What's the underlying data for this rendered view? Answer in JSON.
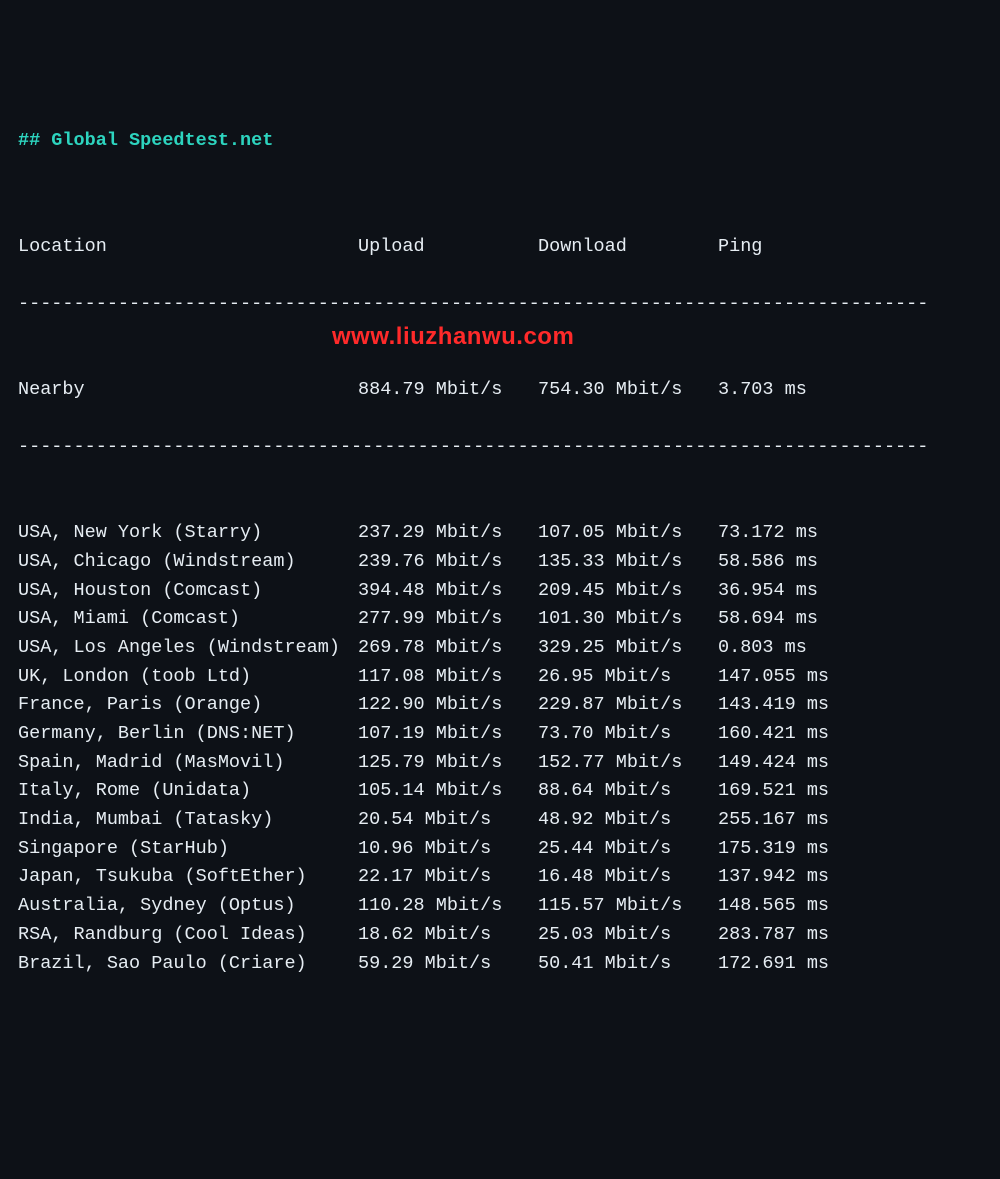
{
  "title": "## Global Speedtest.net",
  "headers": {
    "location": "Location",
    "upload": "Upload",
    "download": "Download",
    "ping": "Ping"
  },
  "dash_full": "----------------------------------------------------------------------------------",
  "nearby": {
    "label": "Nearby",
    "upload": "884.79 Mbit/s",
    "download": "754.30 Mbit/s",
    "ping": "3.703 ms"
  },
  "results": [
    {
      "location": "USA, New York (Starry)",
      "upload": "237.29 Mbit/s",
      "download": "107.05 Mbit/s",
      "ping": "73.172 ms"
    },
    {
      "location": "USA, Chicago (Windstream)",
      "upload": "239.76 Mbit/s",
      "download": "135.33 Mbit/s",
      "ping": "58.586 ms"
    },
    {
      "location": "USA, Houston (Comcast)",
      "upload": "394.48 Mbit/s",
      "download": "209.45 Mbit/s",
      "ping": "36.954 ms"
    },
    {
      "location": "USA, Miami (Comcast)",
      "upload": "277.99 Mbit/s",
      "download": "101.30 Mbit/s",
      "ping": "58.694 ms"
    },
    {
      "location": "USA, Los Angeles (Windstream)",
      "upload": "269.78 Mbit/s",
      "download": "329.25 Mbit/s",
      "ping": "0.803 ms"
    },
    {
      "location": "UK, London (toob Ltd)",
      "upload": "117.08 Mbit/s",
      "download": "26.95 Mbit/s",
      "ping": "147.055 ms"
    },
    {
      "location": "France, Paris (Orange)",
      "upload": "122.90 Mbit/s",
      "download": "229.87 Mbit/s",
      "ping": "143.419 ms"
    },
    {
      "location": "Germany, Berlin (DNS:NET)",
      "upload": "107.19 Mbit/s",
      "download": "73.70 Mbit/s",
      "ping": "160.421 ms"
    },
    {
      "location": "Spain, Madrid (MasMovil)",
      "upload": "125.79 Mbit/s",
      "download": "152.77 Mbit/s",
      "ping": "149.424 ms"
    },
    {
      "location": "Italy, Rome (Unidata)",
      "upload": "105.14 Mbit/s",
      "download": "88.64 Mbit/s",
      "ping": "169.521 ms"
    },
    {
      "location": "India, Mumbai (Tatasky)",
      "upload": "20.54 Mbit/s",
      "download": "48.92 Mbit/s",
      "ping": "255.167 ms"
    },
    {
      "location": "Singapore (StarHub)",
      "upload": "10.96 Mbit/s",
      "download": "25.44 Mbit/s",
      "ping": "175.319 ms"
    },
    {
      "location": "Japan, Tsukuba (SoftEther)",
      "upload": "22.17 Mbit/s",
      "download": "16.48 Mbit/s",
      "ping": "137.942 ms"
    },
    {
      "location": "Australia, Sydney (Optus)",
      "upload": "110.28 Mbit/s",
      "download": "115.57 Mbit/s",
      "ping": "148.565 ms"
    },
    {
      "location": "RSA, Randburg (Cool Ideas)",
      "upload": "18.62 Mbit/s",
      "download": "25.03 Mbit/s",
      "ping": "283.787 ms"
    },
    {
      "location": "Brazil, Sao Paulo (Criare)",
      "upload": "59.29 Mbit/s",
      "download": "50.41 Mbit/s",
      "ping": "172.691 ms"
    }
  ],
  "watermark": "www.liuzhanwu.com"
}
